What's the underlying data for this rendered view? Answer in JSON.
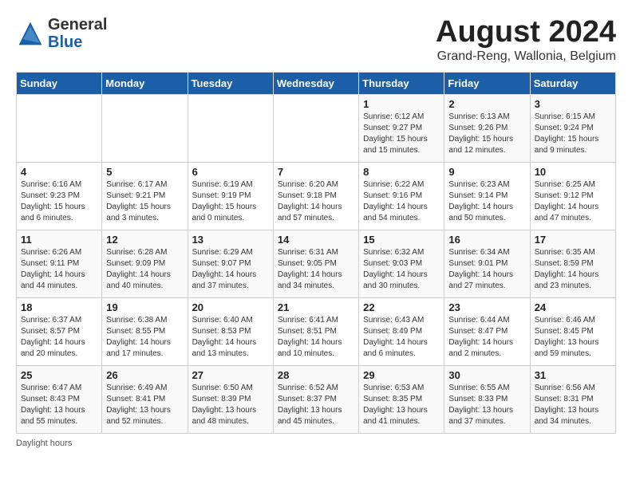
{
  "header": {
    "logo_general": "General",
    "logo_blue": "Blue",
    "title": "August 2024",
    "location": "Grand-Reng, Wallonia, Belgium"
  },
  "days_of_week": [
    "Sunday",
    "Monday",
    "Tuesday",
    "Wednesday",
    "Thursday",
    "Friday",
    "Saturday"
  ],
  "footnote": "Daylight hours",
  "weeks": [
    [
      {
        "day": "",
        "info": ""
      },
      {
        "day": "",
        "info": ""
      },
      {
        "day": "",
        "info": ""
      },
      {
        "day": "",
        "info": ""
      },
      {
        "day": "1",
        "info": "Sunrise: 6:12 AM\nSunset: 9:27 PM\nDaylight: 15 hours\nand 15 minutes."
      },
      {
        "day": "2",
        "info": "Sunrise: 6:13 AM\nSunset: 9:26 PM\nDaylight: 15 hours\nand 12 minutes."
      },
      {
        "day": "3",
        "info": "Sunrise: 6:15 AM\nSunset: 9:24 PM\nDaylight: 15 hours\nand 9 minutes."
      }
    ],
    [
      {
        "day": "4",
        "info": "Sunrise: 6:16 AM\nSunset: 9:23 PM\nDaylight: 15 hours\nand 6 minutes."
      },
      {
        "day": "5",
        "info": "Sunrise: 6:17 AM\nSunset: 9:21 PM\nDaylight: 15 hours\nand 3 minutes."
      },
      {
        "day": "6",
        "info": "Sunrise: 6:19 AM\nSunset: 9:19 PM\nDaylight: 15 hours\nand 0 minutes."
      },
      {
        "day": "7",
        "info": "Sunrise: 6:20 AM\nSunset: 9:18 PM\nDaylight: 14 hours\nand 57 minutes."
      },
      {
        "day": "8",
        "info": "Sunrise: 6:22 AM\nSunset: 9:16 PM\nDaylight: 14 hours\nand 54 minutes."
      },
      {
        "day": "9",
        "info": "Sunrise: 6:23 AM\nSunset: 9:14 PM\nDaylight: 14 hours\nand 50 minutes."
      },
      {
        "day": "10",
        "info": "Sunrise: 6:25 AM\nSunset: 9:12 PM\nDaylight: 14 hours\nand 47 minutes."
      }
    ],
    [
      {
        "day": "11",
        "info": "Sunrise: 6:26 AM\nSunset: 9:11 PM\nDaylight: 14 hours\nand 44 minutes."
      },
      {
        "day": "12",
        "info": "Sunrise: 6:28 AM\nSunset: 9:09 PM\nDaylight: 14 hours\nand 40 minutes."
      },
      {
        "day": "13",
        "info": "Sunrise: 6:29 AM\nSunset: 9:07 PM\nDaylight: 14 hours\nand 37 minutes."
      },
      {
        "day": "14",
        "info": "Sunrise: 6:31 AM\nSunset: 9:05 PM\nDaylight: 14 hours\nand 34 minutes."
      },
      {
        "day": "15",
        "info": "Sunrise: 6:32 AM\nSunset: 9:03 PM\nDaylight: 14 hours\nand 30 minutes."
      },
      {
        "day": "16",
        "info": "Sunrise: 6:34 AM\nSunset: 9:01 PM\nDaylight: 14 hours\nand 27 minutes."
      },
      {
        "day": "17",
        "info": "Sunrise: 6:35 AM\nSunset: 8:59 PM\nDaylight: 14 hours\nand 23 minutes."
      }
    ],
    [
      {
        "day": "18",
        "info": "Sunrise: 6:37 AM\nSunset: 8:57 PM\nDaylight: 14 hours\nand 20 minutes."
      },
      {
        "day": "19",
        "info": "Sunrise: 6:38 AM\nSunset: 8:55 PM\nDaylight: 14 hours\nand 17 minutes."
      },
      {
        "day": "20",
        "info": "Sunrise: 6:40 AM\nSunset: 8:53 PM\nDaylight: 14 hours\nand 13 minutes."
      },
      {
        "day": "21",
        "info": "Sunrise: 6:41 AM\nSunset: 8:51 PM\nDaylight: 14 hours\nand 10 minutes."
      },
      {
        "day": "22",
        "info": "Sunrise: 6:43 AM\nSunset: 8:49 PM\nDaylight: 14 hours\nand 6 minutes."
      },
      {
        "day": "23",
        "info": "Sunrise: 6:44 AM\nSunset: 8:47 PM\nDaylight: 14 hours\nand 2 minutes."
      },
      {
        "day": "24",
        "info": "Sunrise: 6:46 AM\nSunset: 8:45 PM\nDaylight: 13 hours\nand 59 minutes."
      }
    ],
    [
      {
        "day": "25",
        "info": "Sunrise: 6:47 AM\nSunset: 8:43 PM\nDaylight: 13 hours\nand 55 minutes."
      },
      {
        "day": "26",
        "info": "Sunrise: 6:49 AM\nSunset: 8:41 PM\nDaylight: 13 hours\nand 52 minutes."
      },
      {
        "day": "27",
        "info": "Sunrise: 6:50 AM\nSunset: 8:39 PM\nDaylight: 13 hours\nand 48 minutes."
      },
      {
        "day": "28",
        "info": "Sunrise: 6:52 AM\nSunset: 8:37 PM\nDaylight: 13 hours\nand 45 minutes."
      },
      {
        "day": "29",
        "info": "Sunrise: 6:53 AM\nSunset: 8:35 PM\nDaylight: 13 hours\nand 41 minutes."
      },
      {
        "day": "30",
        "info": "Sunrise: 6:55 AM\nSunset: 8:33 PM\nDaylight: 13 hours\nand 37 minutes."
      },
      {
        "day": "31",
        "info": "Sunrise: 6:56 AM\nSunset: 8:31 PM\nDaylight: 13 hours\nand 34 minutes."
      }
    ]
  ]
}
